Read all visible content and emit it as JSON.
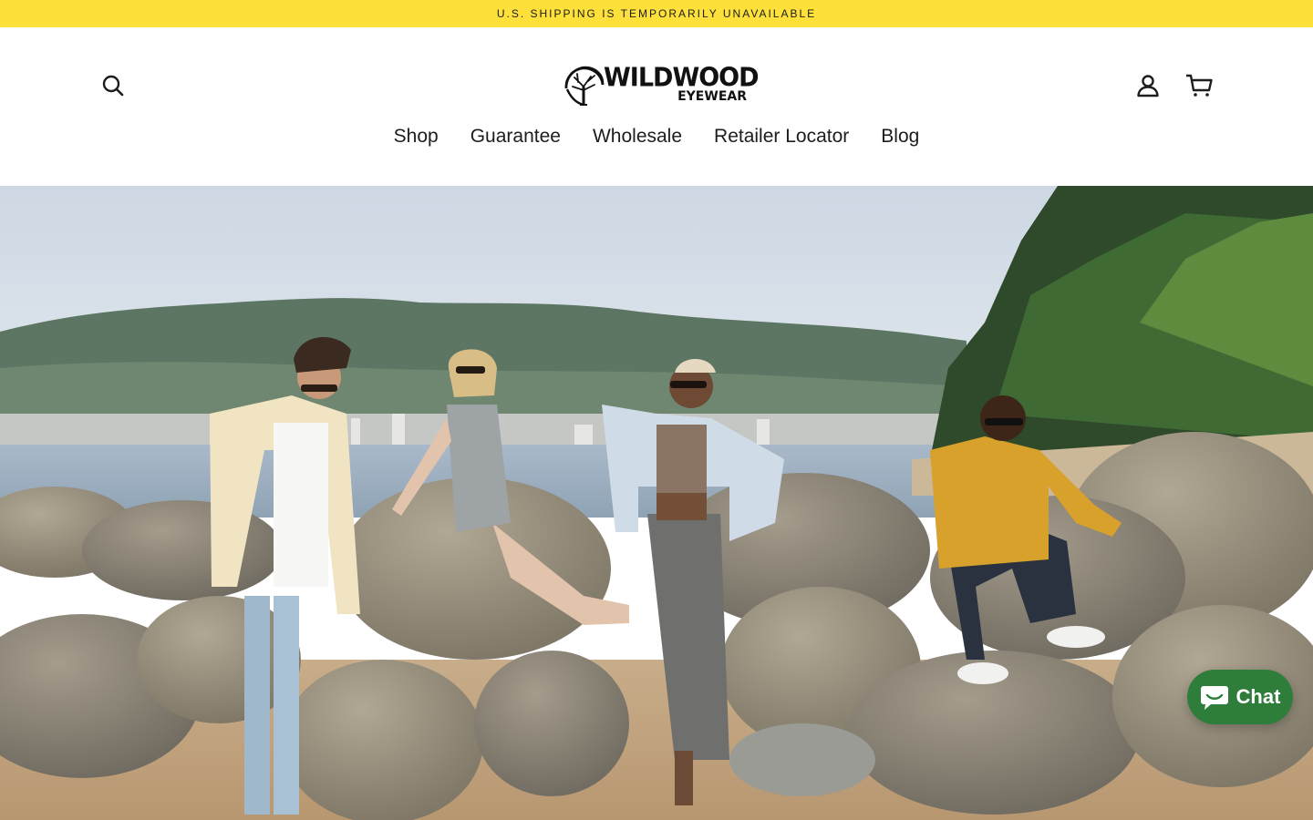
{
  "announcement": {
    "text": "U.S. Shipping is temporarily unavailable",
    "bg_color": "#fde03a"
  },
  "header": {
    "logo": {
      "word1": "WILDWOOD",
      "word2": "EYEWEAR",
      "icon": "tree-logo-icon"
    },
    "icons": {
      "search": "search-icon",
      "account": "user-icon",
      "cart": "cart-icon"
    },
    "nav": [
      {
        "label": "Shop"
      },
      {
        "label": "Guarantee"
      },
      {
        "label": "Wholesale"
      },
      {
        "label": "Retailer Locator"
      },
      {
        "label": "Blog"
      }
    ]
  },
  "hero": {
    "image": "lifestyle-photo-four-models-sunglasses-rocky-beach"
  },
  "chat": {
    "label": "Chat",
    "icon": "chat-bubble-icon",
    "bg_color": "#2e7d3a"
  }
}
